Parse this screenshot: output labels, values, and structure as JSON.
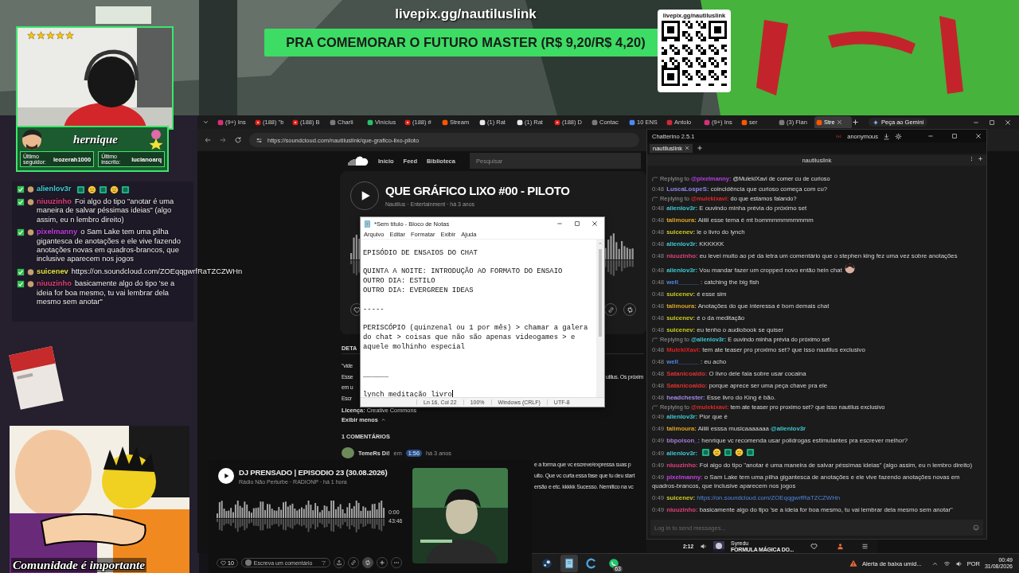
{
  "overlay": {
    "donation_url": "livepix.gg/nautiluslink",
    "banner": "PRA COMEMORAR O FUTURO MASTER (R$ 9,20/R$ 4,20)",
    "qr_label": "livepix.gg/nautiluslink",
    "stars": 5,
    "streamer": "hernique",
    "follower_label": "Último seguidor:",
    "follower": "leozerah1000",
    "sub_label": "Último inscrito:",
    "sub": "lucianoarq",
    "chat": [
      {
        "kind": "emotes",
        "user": "alienlov3r",
        "color": "#3fd0d8"
      },
      {
        "kind": "text",
        "user": "niuuzinho",
        "color": "#e0407a",
        "text": "Foi algo do tipo \"anotar é uma maneira de salvar péssimas ideias\" (algo assim, eu n lembro direito)"
      },
      {
        "kind": "text",
        "user": "pixelmanny",
        "color": "#c040e0",
        "text": "o Sam Lake tem uma pilha gigantesca de anotações e ele vive fazendo anotações novas em quadros-brancos, que inclusive aparecem nos jogos"
      },
      {
        "kind": "text",
        "user": "suicenev",
        "color": "#e0e040",
        "text": "https://on.soundcloud.com/ZOEqqgwrfRaTZCZWHn"
      },
      {
        "kind": "text",
        "user": "niuuzinho",
        "color": "#e0407a",
        "text": "basicamente algo do tipo 'se a ideia for boa mesmo, tu vai lembrar dela mesmo sem anotar\""
      }
    ],
    "caption": "Comunidade é importante"
  },
  "browser": {
    "tabs": [
      {
        "label": "(9+) Ins",
        "selected": false
      },
      {
        "label": "(188) \"b",
        "kind": "video",
        "selected": false
      },
      {
        "label": "(188) B",
        "kind": "video",
        "selected": false
      },
      {
        "label": "Charli",
        "kind": "page",
        "selected": false
      },
      {
        "label": "Vinícius",
        "kind": "chat",
        "selected": false
      },
      {
        "label": "(188) #",
        "kind": "video",
        "selected": false
      },
      {
        "label": "Stream",
        "kind": "sound",
        "selected": false
      },
      {
        "label": "(1) Rat",
        "kind": "post",
        "selected": false
      },
      {
        "label": "(1) Rat",
        "kind": "post",
        "selected": false
      },
      {
        "label": "(188) D",
        "kind": "video",
        "selected": false
      },
      {
        "label": "Contac",
        "kind": "page",
        "selected": false
      },
      {
        "label": "10 ENS",
        "kind": "search",
        "selected": false
      },
      {
        "label": "Antolo",
        "kind": "letter",
        "selected": false
      },
      {
        "label": "(9+) Ins",
        "selected": false
      },
      {
        "label": "ser",
        "kind": "sound",
        "selected": false
      },
      {
        "label": "(3) Flan",
        "kind": "page",
        "selected": false
      },
      {
        "label": "Stre",
        "kind": "sound",
        "selected": true
      }
    ],
    "assistant_button": "Peça ao Gemini",
    "url": "https://soundcloud.com/nautiluslink/que-grafico-lixo-piloto",
    "page": {
      "nav": [
        "Início",
        "Feed",
        "Biblioteca"
      ],
      "search_placeholder": "Pesquisar",
      "title": "QUE GRÁFICO LIXO #00 - PILOTO",
      "meta": "Nautilus · Entertainment · há 3 anos",
      "details_heading": "DETA",
      "details": [
        {
          "left": "\"vide"
        },
        {
          "left": "Esse",
          "right": "utilus. Os próxim"
        },
        {
          "left": "em u"
        },
        {
          "left": "Escr"
        }
      ],
      "license": "**Licença:** Creative Commons",
      "show_less": "Exibir menos",
      "comments_heading": "1 COMENTÁRIOS",
      "comment": {
        "user": "TemeRs Di!",
        "at": "em",
        "time": "1:56",
        "age": "há 3 anos",
        "lines": [
          "e a forma que vc escreve/expressa suas p",
          "uito. Que vc curta essa fase que tu deu start",
          "ersão e etc. kkkkk Sucesso. Nemítico na vc"
        ]
      }
    }
  },
  "notepad": {
    "title": "*Sem título - Bloco de Notas",
    "menu": [
      "Arquivo",
      "Editar",
      "Formatar",
      "Exibir",
      "Ajuda"
    ],
    "content": "\nEPISÓDIO DE ENSAIOS DO CHAT\n\nQUINTA A NOITE: INTRODUÇÃO AO FORMATO DO ENSAIO\nOUTRO DIA: ESTILO\nOUTRO DIA: EVERGREEN IDEAS\n\n-----\n\nPERISCÓPIO (quinzenal ou 1 por mês) > chamar a galera do chat > coisas que não são apenas videogames > e aquele molhinho especial\n\n\n______\n\nlynch meditação livro",
    "status": [
      "Ln 16, Col 22",
      "100%",
      "Windows (CRLF)",
      "UTF-8"
    ]
  },
  "chatterino": {
    "title": "Chatterino 2.5.1",
    "account": "anonymous",
    "tabs": [
      {
        "label": "nautiluslink",
        "selected": true
      }
    ],
    "channel": "nautiluslink",
    "messages": [
      {
        "kind": "reply",
        "label": "Replying to",
        "user": "@pixelmanny:",
        "color": "#b040e0",
        "text": "@MulekiXavi de comer cu de curioso"
      },
      {
        "kind": "message",
        "time": "0:48",
        "user": "LuscaLospeS:",
        "color": "#8f86f0",
        "text": "coincidência que curioso começa com cu?"
      },
      {
        "kind": "reply",
        "label": "Replying to",
        "user": "@mulekixavi:",
        "color": "#e02828",
        "text": "do que estamos falando?"
      },
      {
        "kind": "message",
        "time": "0:48",
        "user": "alienlov3r:",
        "color": "#3fc8d0",
        "text": "E ouvindo minha prévia do próximo set"
      },
      {
        "kind": "message",
        "time": "0:48",
        "user": "talimoura:",
        "color": "#d9a526",
        "text": "Aiiiii esse tema é mt bommmmmmmmmm"
      },
      {
        "kind": "message",
        "time": "0:48",
        "user": "suicenev:",
        "color": "#c9c826",
        "text": "le o livro do lynch"
      },
      {
        "kind": "message",
        "time": "0:48",
        "user": "alienlov3r:",
        "color": "#3fc8d0",
        "text": "KKKKKK"
      },
      {
        "kind": "message",
        "time": "0:48",
        "user": "niuuzinho:",
        "color": "#e0407a",
        "text": "eu levei muito ao pé da letra um comentário que o stephen king fez uma vez sobre anotações"
      },
      {
        "kind": "emote_after",
        "time": "0:48",
        "user": "alienlov3r:",
        "color": "#3fc8d0",
        "text": "Vou mandar fazer um cropped novo então hein chat"
      },
      {
        "kind": "message",
        "time": "0:48",
        "user": "well______",
        "color": "#4f86e0",
        "text": ": catching the big fish"
      },
      {
        "kind": "message",
        "time": "0:48",
        "user": "suicenev:",
        "color": "#c9c826",
        "text": "é esse sim"
      },
      {
        "kind": "message",
        "time": "0:48",
        "user": "talimoura:",
        "color": "#d9a526",
        "text": "Anotações do que interessa é bom demais chat"
      },
      {
        "kind": "message",
        "time": "0:48",
        "user": "suicenev:",
        "color": "#c9c826",
        "text": "é o da meditação"
      },
      {
        "kind": "message",
        "time": "0:48",
        "user": "suicenev:",
        "color": "#c9c826",
        "text": "eu tenho o audiobook se quiser"
      },
      {
        "kind": "reply",
        "label": "Replying to",
        "user": "@alienlov3r:",
        "color": "#3fc8d0",
        "text": "E ouvindo minha prévia do próximo set"
      },
      {
        "kind": "message",
        "time": "0:48",
        "user": "MulekiXavi:",
        "color": "#e02020",
        "text": "tem ate teaser pro proximo set? que isso nautilus exclusivo"
      },
      {
        "kind": "message",
        "time": "0:48",
        "user": "well______",
        "color": "#4f86e0",
        "text": ": eu acho"
      },
      {
        "kind": "message",
        "time": "0:48",
        "user": "Satanicoaldo:",
        "color": "#e03030",
        "text": "O livro dele fala sobre usar cocaina"
      },
      {
        "kind": "message",
        "time": "0:48",
        "user": "Satanicoaldo:",
        "color": "#e03030",
        "text": "porque aprece ser uma peça chave pra ele"
      },
      {
        "kind": "message",
        "time": "0:48",
        "user": "headchester:",
        "color": "#a48ae8",
        "text": "Esse livro do King é bão."
      },
      {
        "kind": "reply",
        "label": "Replying to",
        "user": "@mulekixavi:",
        "color": "#e02828",
        "text": "tem ate teaser pro proximo set? que isso nautilus exclusivo"
      },
      {
        "kind": "message",
        "time": "0:49",
        "user": "alienlov3r:",
        "color": "#3fc8d0",
        "text": "Pior que é"
      },
      {
        "kind": "message",
        "time": "0:49",
        "user": "talimoura:",
        "color": "#d9a526",
        "text": "Aiiiii esssa musicaaaaaaa",
        "mention": "@alienlov3r"
      },
      {
        "kind": "message",
        "time": "0:49",
        "user": "bbpoison_:",
        "color": "#a57ad8",
        "text": "henrique vc recomenda usar polidrogas estimulantes pra escrever melhor?"
      },
      {
        "kind": "emotes",
        "time": "0:49",
        "user": "alienlov3r:",
        "color": "#3fc8d0"
      },
      {
        "kind": "message",
        "time": "0:49",
        "user": "niuuzinho:",
        "color": "#e0407a",
        "text": "Foi algo do tipo \"anotar é uma maneira de salvar péssimas ideias\" (algo assim, eu n lembro direito)"
      },
      {
        "kind": "message",
        "time": "0:49",
        "user": "pixelmanny:",
        "color": "#c040e0",
        "text": "o Sam Lake tem uma pilha gigantesca de anotações e ele vive fazendo anotações novas em quadros-brancos, que inclusive aparecem nos jogos"
      },
      {
        "kind": "link",
        "time": "0:49",
        "user": "suicenev:",
        "color": "#c9c826",
        "text": "https://on.soundcloud.com/ZOEqqgwrfRaTZCZWHn"
      },
      {
        "kind": "message",
        "time": "0:49",
        "user": "niuuzinho:",
        "color": "#e0407a",
        "text": "basicamente algo do tipo 'se a ideia for boa mesmo, tu vai lembrar dela mesmo sem anotar\""
      }
    ],
    "input_placeholder": "Log in to send messages..."
  },
  "player": {
    "title": "DJ PRENSADO | EPISODIO 23 (30.08.2026)",
    "meta": "Rádio Não Perturbe · RADIONP · há 1 hora",
    "elapsed": "0:00",
    "duration": "43:46",
    "likes": "10",
    "comment_placeholder": "Escreva um comentário"
  },
  "media": {
    "time": "2:12",
    "artist": "Syredu",
    "track": "FORMULA MÁGICA DO..."
  },
  "taskbar": {
    "apps": [
      {
        "kind": "game",
        "selected": false
      },
      {
        "kind": "notes",
        "selected": true
      },
      {
        "kind": "browser",
        "selected": false
      },
      {
        "kind": "messenger",
        "selected": false,
        "badge": "63"
      }
    ],
    "alert": "Alerta de baixa umid...",
    "language": "POR",
    "time": "00:49",
    "date": "31/08/2026"
  }
}
